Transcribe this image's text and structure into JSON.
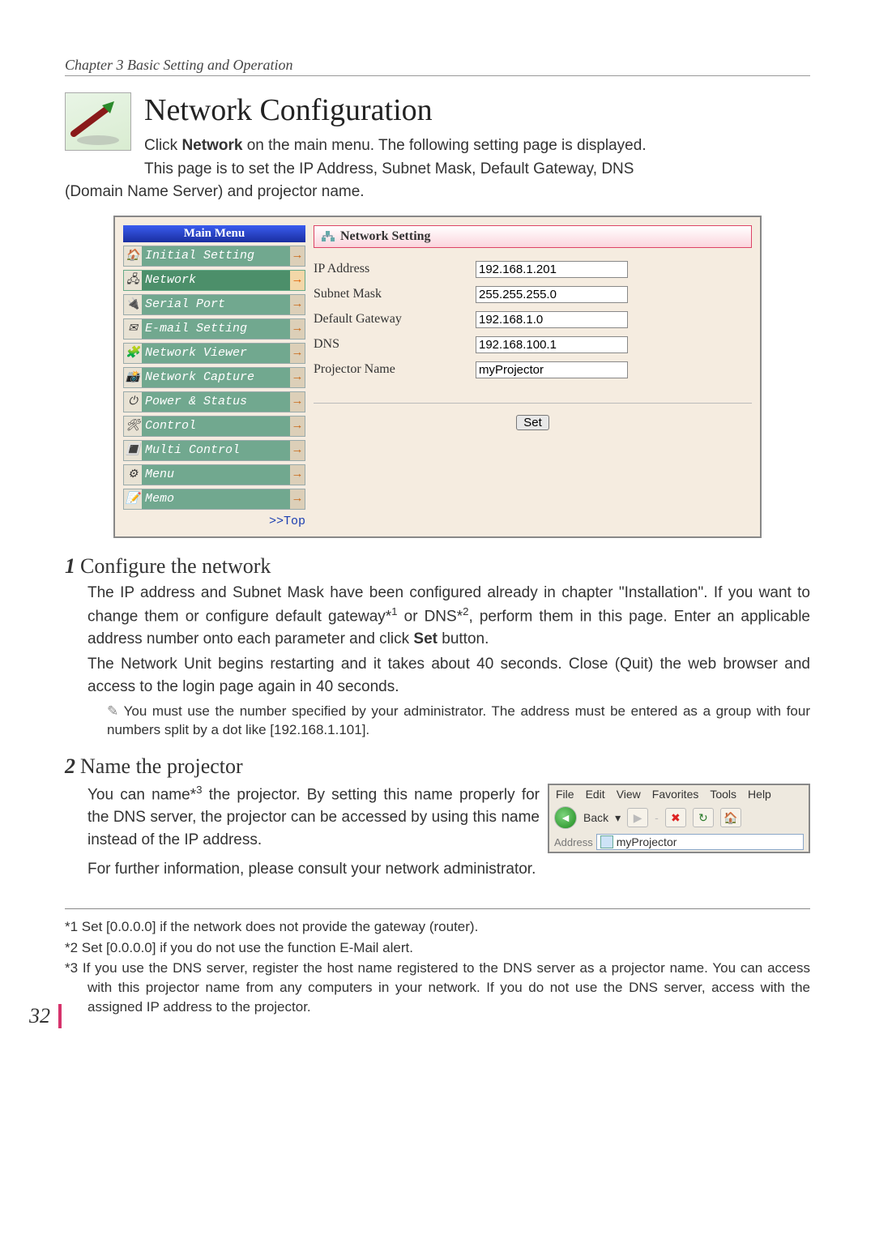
{
  "chapter": "Chapter 3 Basic Setting and Operation",
  "title": "Network Configuration",
  "intro1_a": "Click ",
  "intro1_bold": "Network",
  "intro1_b": " on the main menu. The following setting page is displayed.",
  "intro2": "This page is to set the IP Address, Subnet Mask, Default Gateway, DNS",
  "intro3": "(Domain Name Server) and projector name.",
  "menu": {
    "header": "Main Menu",
    "items": [
      {
        "label": "Initial Setting",
        "active": false,
        "icon": "🏠"
      },
      {
        "label": "Network",
        "active": true,
        "icon": "🖧"
      },
      {
        "label": "Serial Port",
        "active": false,
        "icon": "🔌"
      },
      {
        "label": "E-mail Setting",
        "active": false,
        "icon": "✉"
      },
      {
        "label": "Network Viewer",
        "active": false,
        "icon": "🧩"
      },
      {
        "label": "Network Capture",
        "active": false,
        "icon": "📸"
      },
      {
        "label": "Power & Status",
        "active": false,
        "icon": "⏻"
      },
      {
        "label": "Control",
        "active": false,
        "icon": "🛠"
      },
      {
        "label": "Multi Control",
        "active": false,
        "icon": "🔳"
      },
      {
        "label": "Menu",
        "active": false,
        "icon": "⚙"
      },
      {
        "label": "Memo",
        "active": false,
        "icon": "📝"
      }
    ],
    "top": ">>Top"
  },
  "settings": {
    "header": "Network Setting",
    "fields": {
      "ip": {
        "label": "IP Address",
        "value": "192.168.1.201"
      },
      "mask": {
        "label": "Subnet Mask",
        "value": "255.255.255.0"
      },
      "gw": {
        "label": "Default Gateway",
        "value": "192.168.1.0"
      },
      "dns": {
        "label": "DNS",
        "value": "192.168.100.1"
      },
      "name": {
        "label": "Projector Name",
        "value": "myProjector"
      }
    },
    "set_btn": "Set"
  },
  "step1": {
    "num": "1",
    "title": "Configure the network",
    "p1": "The IP address and Subnet Mask have been configured already in chapter \"Installation\". If you want to change them or configure default gateway*",
    "p1_sup": "1",
    "p1_b": " or DNS*",
    "p1_sup2": "2",
    "p1_c": ", perform them in this page. Enter an applicable address number onto each parameter and click ",
    "p1_bold": "Set",
    "p1_d": " button.",
    "p2": "The Network Unit begins restarting and it takes about 40 seconds. Close (Quit) the web browser and access to the login page again in 40 seconds.",
    "note": "You must use the number specified by your administrator. The address must be entered as a group with four numbers split by a dot like [192.168.1.101]."
  },
  "step2": {
    "num": "2",
    "title": "Name the projector",
    "p1_a": "You can name*",
    "p1_sup": "3",
    "p1_b": " the projector. By setting this name properly for the DNS server, the projector can be accessed by using this name instead of the IP address.",
    "p2": "For further information, please consult your network administrator."
  },
  "ie": {
    "menu": [
      "File",
      "Edit",
      "View",
      "Favorites",
      "Tools",
      "Help"
    ],
    "back": "Back",
    "addr_label": "Address",
    "addr_value": "myProjector"
  },
  "footnotes": {
    "f1": "*1 Set [0.0.0.0] if the network does not provide the gateway (router).",
    "f2": "*2 Set [0.0.0.0] if you do not use the function E-Mail alert.",
    "f3": "*3 If you use the DNS server, register the host name registered to the DNS server as a projector name. You can access with this projector name from any computers in your network. If you do not use the DNS server, access with the assigned IP address to the projector."
  },
  "page_number": "32"
}
